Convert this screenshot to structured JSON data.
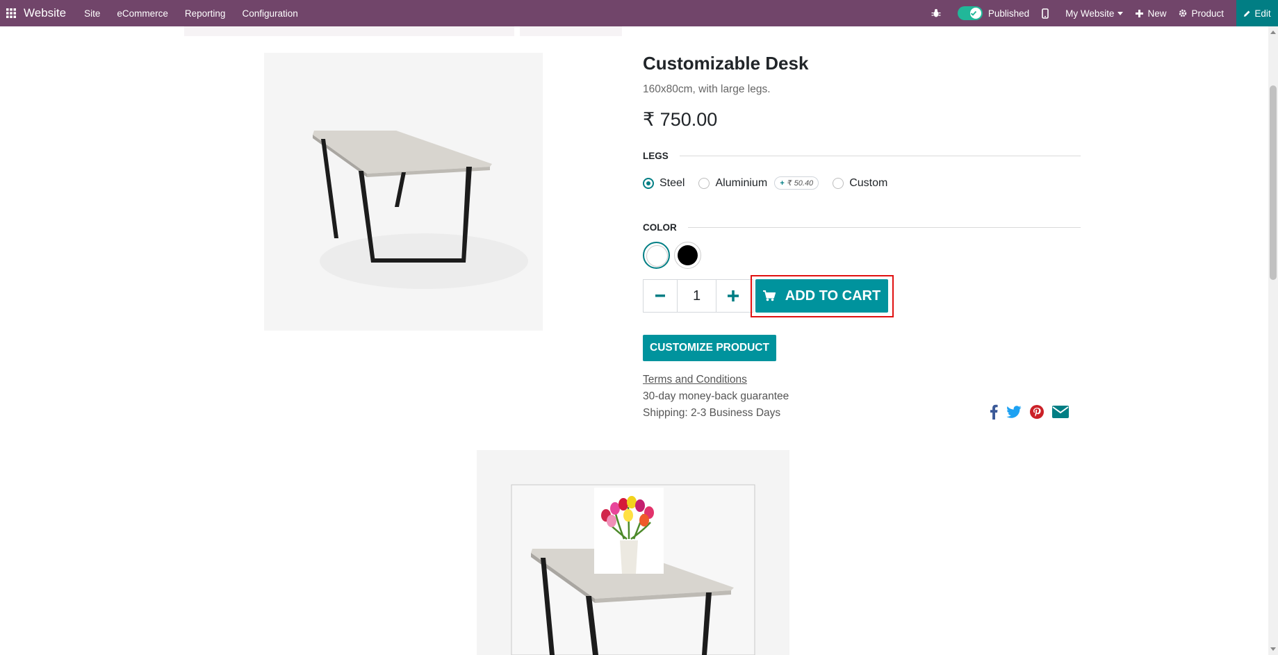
{
  "navbar": {
    "brand": "Website",
    "menu": [
      "Site",
      "eCommerce",
      "Reporting",
      "Configuration"
    ],
    "published_label": "Published",
    "my_website_label": "My Website",
    "new_label": "New",
    "product_label": "Product",
    "edit_label": "Edit"
  },
  "product": {
    "name": "Customizable Desk",
    "description": "160x80cm, with large legs.",
    "price": "₹ 750.00",
    "legs": {
      "label": "LEGS",
      "options": [
        "Steel",
        "Aluminium",
        "Custom"
      ],
      "selected": "Steel",
      "aluminium_extra": "₹ 50.40",
      "extra_prefix": "+"
    },
    "color": {
      "label": "COLOR",
      "options": [
        "white",
        "black"
      ],
      "selected": "white"
    },
    "quantity": "1",
    "add_to_cart_label": "ADD TO CART",
    "customize_label": "CUSTOMIZE PRODUCT",
    "terms_label": "Terms and Conditions",
    "guarantee": "30-day money-back guarantee",
    "shipping": "Shipping: 2-3 Business Days"
  },
  "share": [
    "facebook-icon",
    "twitter-icon",
    "pinterest-icon",
    "email-icon"
  ],
  "colors": {
    "navbar": "#71456a",
    "accent": "#00939d",
    "edit_bg": "#017e84",
    "highlight": "#e01010"
  }
}
